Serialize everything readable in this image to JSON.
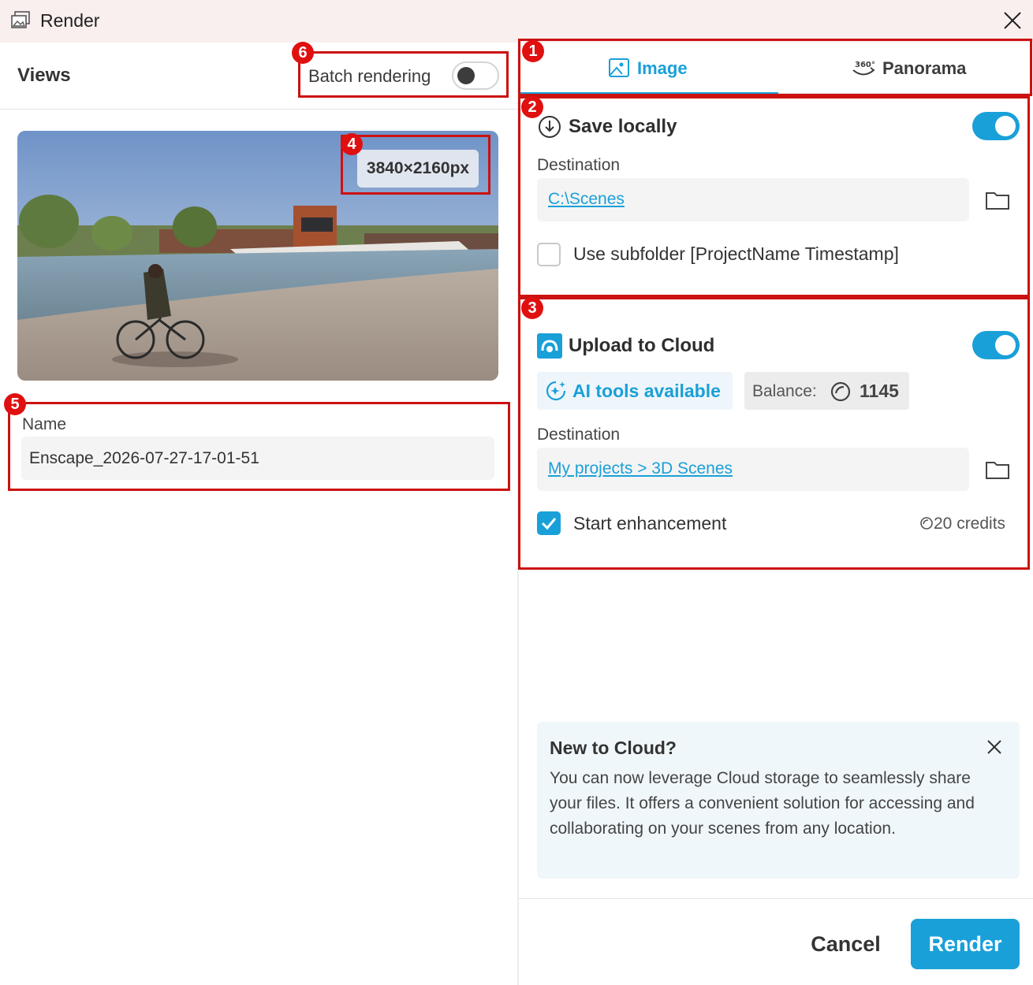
{
  "window": {
    "title": "Render"
  },
  "views": {
    "title": "Views",
    "batch_label": "Batch rendering",
    "batch_enabled": false,
    "resolution": "3840×2160px",
    "name_label": "Name",
    "name_value": "Enscape_2026-07-27-17-01-51"
  },
  "tabs": [
    {
      "label": "Image",
      "icon": "image-icon",
      "active": true
    },
    {
      "label": "Panorama",
      "icon": "360-icon",
      "active": false
    }
  ],
  "save_locally": {
    "title": "Save locally",
    "enabled": true,
    "destination_label": "Destination",
    "destination": "C:\\Scenes",
    "subfolder_label": "Use subfolder [ProjectName Timestamp]",
    "subfolder_checked": false
  },
  "cloud": {
    "title": "Upload to Cloud",
    "enabled": true,
    "ai_label": "AI tools available",
    "balance_label": "Balance:",
    "balance_value": "1145",
    "destination_label": "Destination",
    "destination": "My projects > 3D Scenes",
    "enhance_label": "Start enhancement",
    "enhance_checked": true,
    "credits": "20 credits"
  },
  "info": {
    "title": "New to Cloud?",
    "text": "You can now leverage Cloud storage to seamlessly share your files. It offers a convenient solution for accessing and collaborating on your scenes from any location."
  },
  "footer": {
    "cancel": "Cancel",
    "render": "Render"
  },
  "annotations": [
    "1",
    "2",
    "3",
    "4",
    "5",
    "6"
  ],
  "colors": {
    "accent": "#1aa0d8",
    "annotation": "#cc1111",
    "titlebar": "#f8efee"
  }
}
